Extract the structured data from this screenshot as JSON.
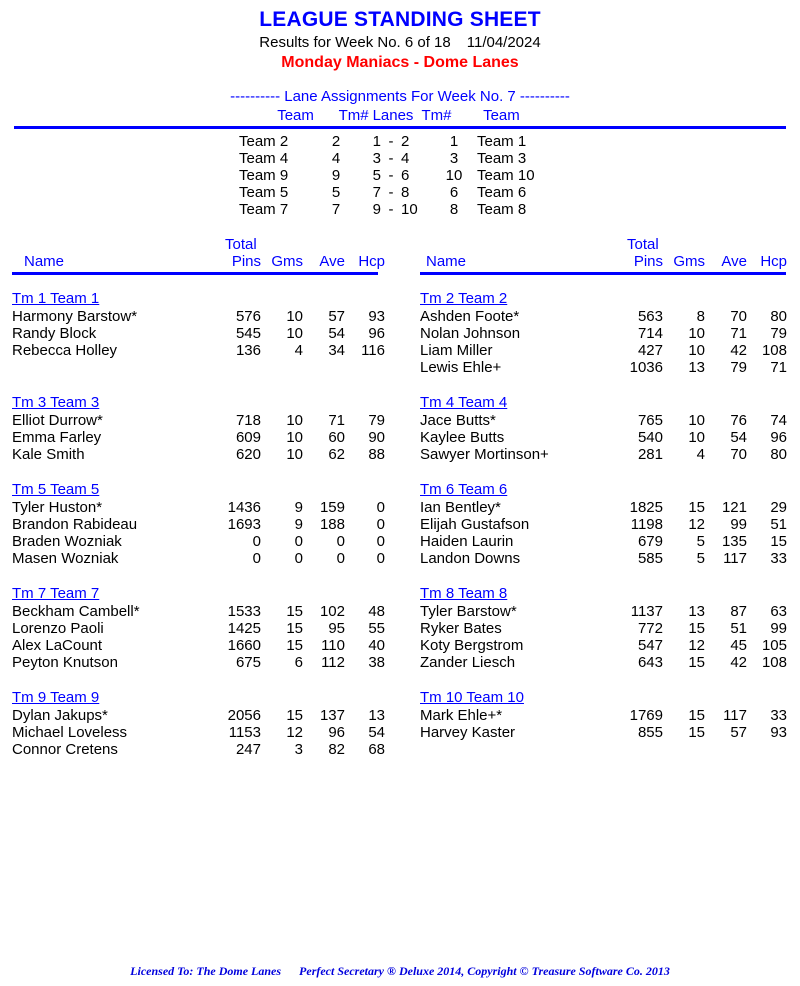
{
  "header": {
    "title": "LEAGUE STANDING SHEET",
    "results_line": "Results for Week No. 6 of 18",
    "date": "11/04/2024",
    "league": "Monday Maniacs - Dome Lanes"
  },
  "lane_assignments": {
    "title": "---------- Lane Assignments For Week No. 7 ----------",
    "headers": {
      "team_left": "Team",
      "tm_num_left": "Tm#",
      "lanes": "Lanes",
      "tm_num_right": "Tm#",
      "team_right": "Team"
    },
    "rows": [
      {
        "team_left": "Team 2",
        "tm_left": "2",
        "lane_a": "1",
        "dash": "-",
        "lane_b": "2",
        "tm_right": "1",
        "team_right": "Team 1"
      },
      {
        "team_left": "Team 4",
        "tm_left": "4",
        "lane_a": "3",
        "dash": "-",
        "lane_b": "4",
        "tm_right": "3",
        "team_right": "Team 3"
      },
      {
        "team_left": "Team 9",
        "tm_left": "9",
        "lane_a": "5",
        "dash": "-",
        "lane_b": "6",
        "tm_right": "10",
        "team_right": "Team 10"
      },
      {
        "team_left": "Team 5",
        "tm_left": "5",
        "lane_a": "7",
        "dash": "-",
        "lane_b": "8",
        "tm_right": "6",
        "team_right": "Team 6"
      },
      {
        "team_left": "Team 7",
        "tm_left": "7",
        "lane_a": "9",
        "dash": "-",
        "lane_b": "10",
        "tm_right": "8",
        "team_right": "Team 8"
      }
    ]
  },
  "standings": {
    "column_headers": {
      "name": "Name",
      "total": "Total",
      "pins": "Pins",
      "gms": "Gms",
      "ave": "Ave",
      "hcp": "Hcp"
    },
    "left_column": [
      {
        "team": "Tm 1 Team 1",
        "bowlers": [
          {
            "name": "Harmony Barstow*",
            "pins": "576",
            "gms": "10",
            "ave": "57",
            "hcp": "93"
          },
          {
            "name": "Randy Block",
            "pins": "545",
            "gms": "10",
            "ave": "54",
            "hcp": "96"
          },
          {
            "name": "Rebecca Holley",
            "pins": "136",
            "gms": "4",
            "ave": "34",
            "hcp": "116"
          }
        ]
      },
      {
        "team": "Tm 3 Team 3",
        "bowlers": [
          {
            "name": "Elliot Durrow*",
            "pins": "718",
            "gms": "10",
            "ave": "71",
            "hcp": "79"
          },
          {
            "name": "Emma Farley",
            "pins": "609",
            "gms": "10",
            "ave": "60",
            "hcp": "90"
          },
          {
            "name": "Kale Smith",
            "pins": "620",
            "gms": "10",
            "ave": "62",
            "hcp": "88"
          }
        ]
      },
      {
        "team": "Tm 5 Team 5",
        "bowlers": [
          {
            "name": "Tyler Huston*",
            "pins": "1436",
            "gms": "9",
            "ave": "159",
            "hcp": "0"
          },
          {
            "name": "Brandon Rabideau",
            "pins": "1693",
            "gms": "9",
            "ave": "188",
            "hcp": "0"
          },
          {
            "name": "Braden Wozniak",
            "pins": "0",
            "gms": "0",
            "ave": "0",
            "hcp": "0"
          },
          {
            "name": "Masen Wozniak",
            "pins": "0",
            "gms": "0",
            "ave": "0",
            "hcp": "0"
          }
        ]
      },
      {
        "team": "Tm 7 Team 7",
        "bowlers": [
          {
            "name": "Beckham Cambell*",
            "pins": "1533",
            "gms": "15",
            "ave": "102",
            "hcp": "48"
          },
          {
            "name": "Lorenzo Paoli",
            "pins": "1425",
            "gms": "15",
            "ave": "95",
            "hcp": "55"
          },
          {
            "name": "Alex LaCount",
            "pins": "1660",
            "gms": "15",
            "ave": "110",
            "hcp": "40"
          },
          {
            "name": "Peyton Knutson",
            "pins": "675",
            "gms": "6",
            "ave": "112",
            "hcp": "38"
          }
        ]
      },
      {
        "team": "Tm 9 Team 9",
        "bowlers": [
          {
            "name": "Dylan Jakups*",
            "pins": "2056",
            "gms": "15",
            "ave": "137",
            "hcp": "13"
          },
          {
            "name": "Michael Loveless",
            "pins": "1153",
            "gms": "12",
            "ave": "96",
            "hcp": "54"
          },
          {
            "name": "Connor Cretens",
            "pins": "247",
            "gms": "3",
            "ave": "82",
            "hcp": "68"
          }
        ]
      }
    ],
    "right_column": [
      {
        "team": "Tm 2 Team 2",
        "bowlers": [
          {
            "name": "Ashden Foote*",
            "pins": "563",
            "gms": "8",
            "ave": "70",
            "hcp": "80"
          },
          {
            "name": "Nolan Johnson",
            "pins": "714",
            "gms": "10",
            "ave": "71",
            "hcp": "79"
          },
          {
            "name": "Liam Miller",
            "pins": "427",
            "gms": "10",
            "ave": "42",
            "hcp": "108"
          },
          {
            "name": "Lewis Ehle+",
            "pins": "1036",
            "gms": "13",
            "ave": "79",
            "hcp": "71"
          }
        ]
      },
      {
        "team": "Tm 4 Team 4",
        "bowlers": [
          {
            "name": "Jace Butts*",
            "pins": "765",
            "gms": "10",
            "ave": "76",
            "hcp": "74"
          },
          {
            "name": "Kaylee Butts",
            "pins": "540",
            "gms": "10",
            "ave": "54",
            "hcp": "96"
          },
          {
            "name": "Sawyer Mortinson+",
            "pins": "281",
            "gms": "4",
            "ave": "70",
            "hcp": "80"
          }
        ]
      },
      {
        "team": "Tm 6 Team 6",
        "bowlers": [
          {
            "name": "Ian Bentley*",
            "pins": "1825",
            "gms": "15",
            "ave": "121",
            "hcp": "29"
          },
          {
            "name": "Elijah Gustafson",
            "pins": "1198",
            "gms": "12",
            "ave": "99",
            "hcp": "51"
          },
          {
            "name": "Haiden Laurin",
            "pins": "679",
            "gms": "5",
            "ave": "135",
            "hcp": "15"
          },
          {
            "name": "Landon Downs",
            "pins": "585",
            "gms": "5",
            "ave": "117",
            "hcp": "33"
          }
        ]
      },
      {
        "team": "Tm 8 Team 8",
        "bowlers": [
          {
            "name": "Tyler Barstow*",
            "pins": "1137",
            "gms": "13",
            "ave": "87",
            "hcp": "63"
          },
          {
            "name": "Ryker Bates",
            "pins": "772",
            "gms": "15",
            "ave": "51",
            "hcp": "99"
          },
          {
            "name": "Koty Bergstrom",
            "pins": "547",
            "gms": "12",
            "ave": "45",
            "hcp": "105"
          },
          {
            "name": "Zander Liesch",
            "pins": "643",
            "gms": "15",
            "ave": "42",
            "hcp": "108"
          }
        ]
      },
      {
        "team": "Tm 10 Team 10",
        "bowlers": [
          {
            "name": "Mark Ehle+*",
            "pins": "1769",
            "gms": "15",
            "ave": "117",
            "hcp": "33"
          },
          {
            "name": "Harvey Kaster",
            "pins": "855",
            "gms": "15",
            "ave": "57",
            "hcp": "93"
          }
        ]
      }
    ]
  },
  "footer": {
    "licensed_to": "Licensed To: The Dome Lanes",
    "software": "Perfect Secretary ® Deluxe  2014, Copyright © Treasure Software Co. 2013"
  },
  "colors": {
    "blue": "#0000ff",
    "red": "#ff0000",
    "black": "#000000"
  }
}
